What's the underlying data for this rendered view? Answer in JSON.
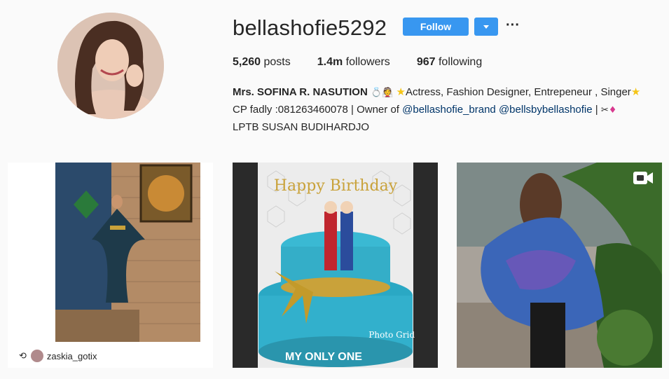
{
  "profile": {
    "username": "bellashofie5292",
    "follow_label": "Follow",
    "more_label": "···",
    "stats": {
      "posts_count": "5,260",
      "posts_label": "posts",
      "followers_count": "1.4m",
      "followers_label": "followers",
      "following_count": "967",
      "following_label": "following"
    },
    "bio": {
      "name": "Mrs. SOFINA R. NASUTION",
      "line1_rest": "Actress, Fashion Designer, Entrepeneur , Singer",
      "line2_prefix": "CP fadly :081263460078 | Owner of",
      "mention1": "@bellashofie_brand",
      "mention2": "@bellsbybellashofie",
      "line2_sep": "|",
      "line3": "LPTB SUSAN BUDIHARDJO"
    }
  },
  "posts": [
    {
      "repost_user": "zaskia_gotix"
    },
    {
      "cake_top_text": "Happy Birthday",
      "cake_bottom_text": "MY ONLY ONE",
      "watermark": "Photo Grid"
    },
    {
      "is_video": true
    }
  ],
  "colors": {
    "accent": "#3897f0",
    "link": "#003569",
    "background": "#fafafa"
  }
}
